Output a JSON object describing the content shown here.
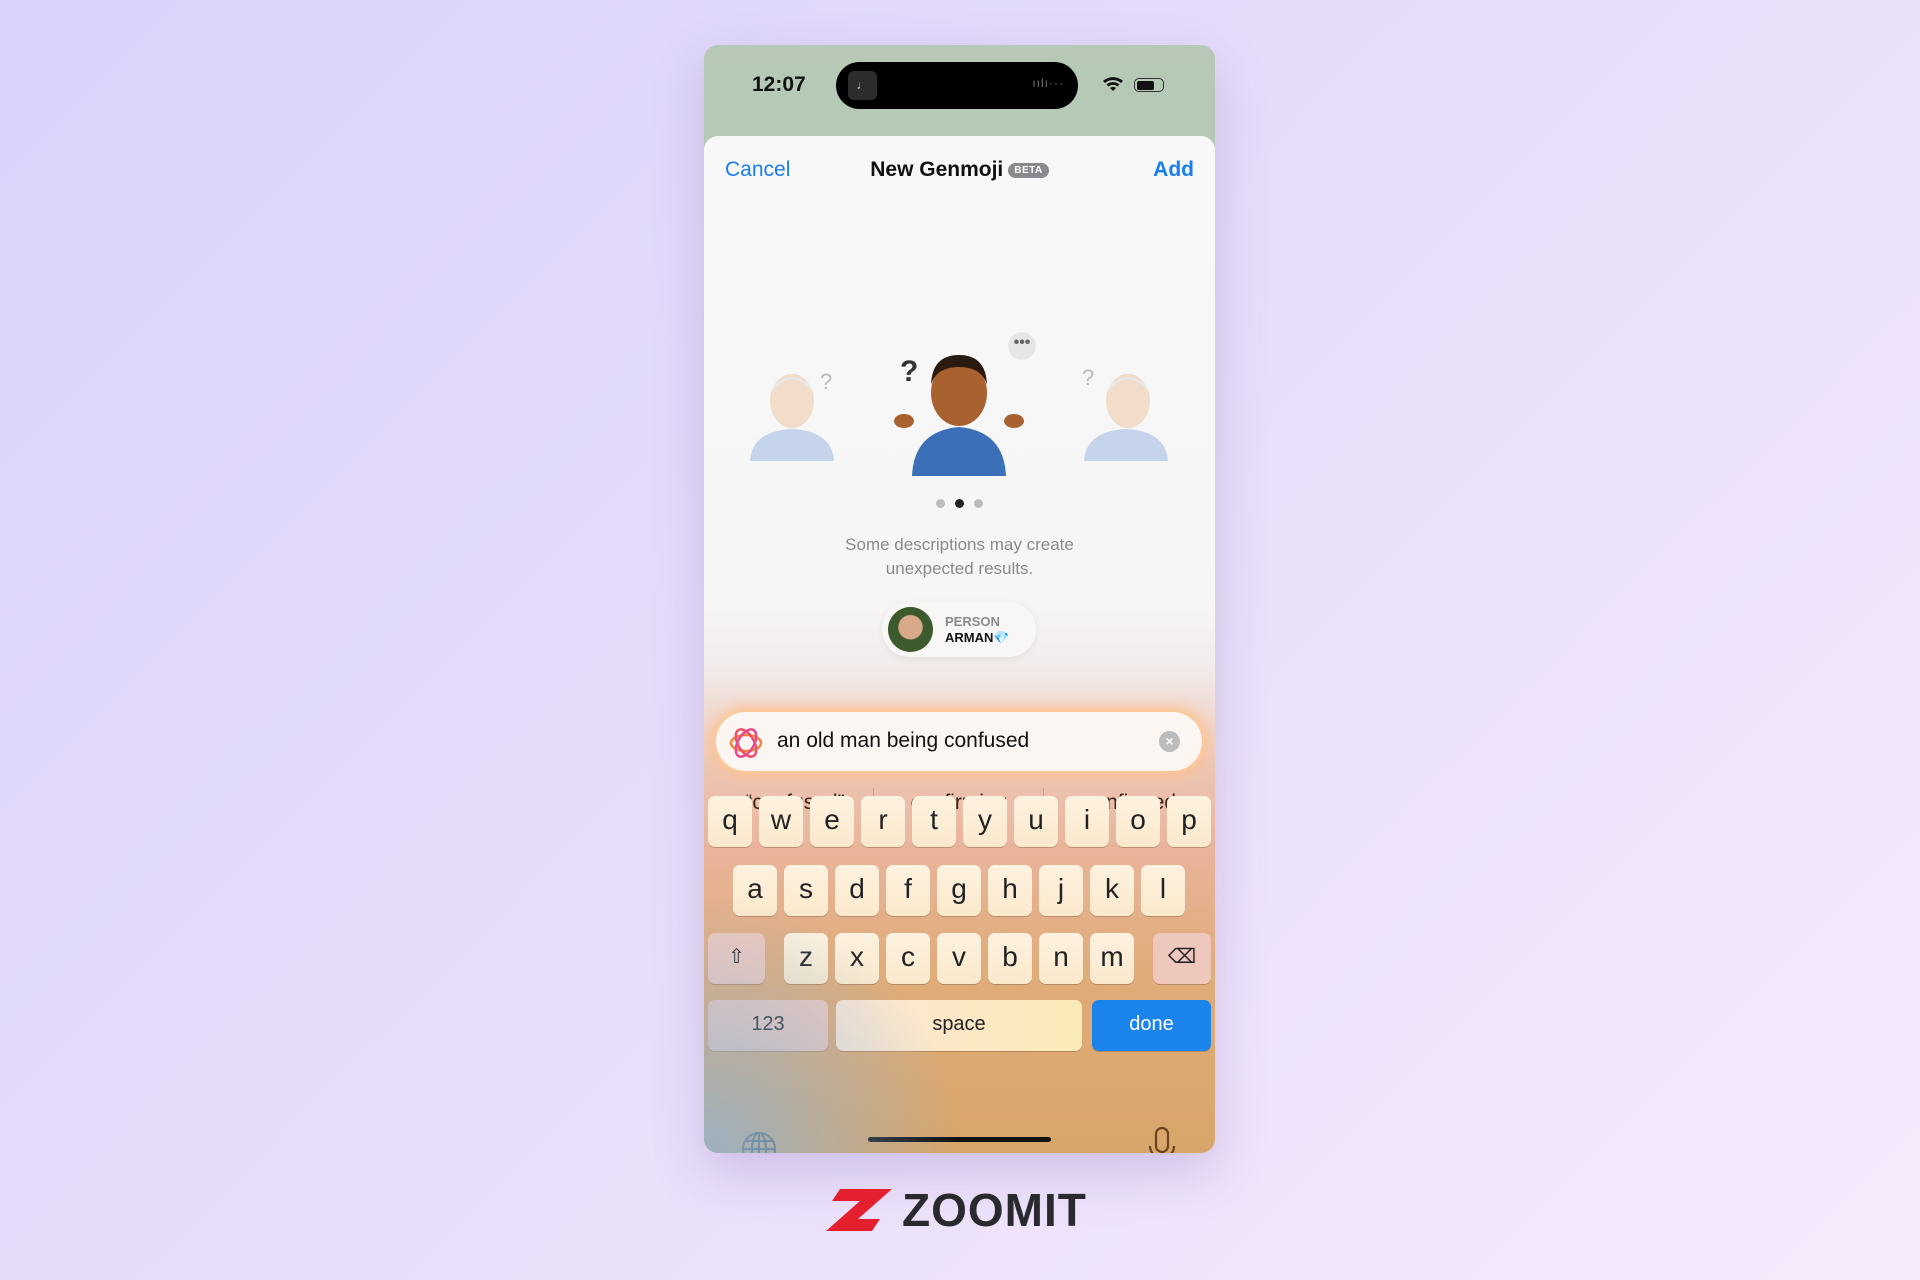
{
  "status_bar": {
    "time": "12:07",
    "island_art": "♩",
    "island_wave": "ıılı···",
    "icons": [
      "wifi-icon",
      "battery-icon"
    ]
  },
  "nav": {
    "cancel_label": "Cancel",
    "title": "New Genmoji",
    "badge": "BETA",
    "add_label": "Add"
  },
  "preview": {
    "emojis": [
      "confused-old-man-left",
      "shrugging-man-center",
      "confused-old-man-right"
    ],
    "more_label": "•••",
    "page_count": 3,
    "current_page": 2,
    "hint_line1": "Some descriptions may create",
    "hint_line2": "unexpected results."
  },
  "person": {
    "label": "PERSON",
    "name": "ARMAN",
    "emoji": "💎"
  },
  "prompt": {
    "value": "an old man being confused",
    "clear_label": "×"
  },
  "suggestions": [
    "“confused”",
    "confirming",
    "confirmed"
  ],
  "keyboard": {
    "row1": [
      "q",
      "w",
      "e",
      "r",
      "t",
      "y",
      "u",
      "i",
      "o",
      "p"
    ],
    "row2": [
      "a",
      "s",
      "d",
      "f",
      "g",
      "h",
      "j",
      "k",
      "l"
    ],
    "row3": [
      "z",
      "x",
      "c",
      "v",
      "b",
      "n",
      "m"
    ],
    "shift": "⇧",
    "delete": "⌫",
    "numbers_label": "123",
    "space_label": "space",
    "done_label": "done"
  },
  "watermark": {
    "text": "ZOOMIT"
  },
  "colors": {
    "accent": "#1a7ef0",
    "done": "#1a84ec",
    "logo_red": "#e4202e"
  }
}
